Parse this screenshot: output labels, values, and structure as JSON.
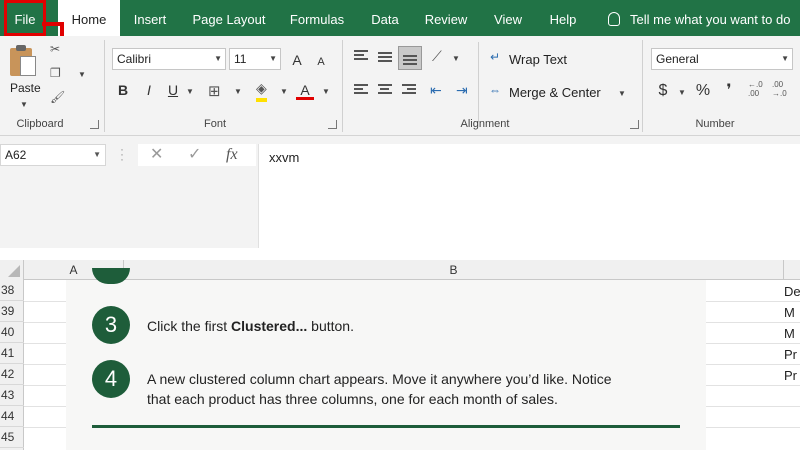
{
  "ribbon_tabs": {
    "file": "File",
    "home": "Home",
    "insert": "Insert",
    "page_layout": "Page Layout",
    "formulas": "Formulas",
    "data": "Data",
    "review": "Review",
    "view": "View",
    "help": "Help",
    "tell_me": "Tell me what you want to do"
  },
  "clipboard": {
    "paste": "Paste",
    "label": "Clipboard"
  },
  "font": {
    "name": "Calibri",
    "size": "11",
    "label": "Font",
    "bold": "B",
    "italic": "I",
    "underline": "U",
    "increase": "A",
    "decrease": "A",
    "color_letter": "A"
  },
  "alignment": {
    "wrap_text": "Wrap Text",
    "merge_center": "Merge & Center",
    "label": "Alignment"
  },
  "number": {
    "format": "General",
    "label": "Number",
    "currency": "$",
    "percent": "%",
    "comma": "❜"
  },
  "formula_bar": {
    "name_box": "A62",
    "cancel": "✕",
    "enter": "✓",
    "fx": "fx",
    "content": "xxvm"
  },
  "columns": [
    "A",
    "B"
  ],
  "rows": [
    "38",
    "39",
    "40",
    "41",
    "42",
    "43",
    "44",
    "45"
  ],
  "card": {
    "step3_number": "3",
    "step3_pre": "Click the first ",
    "step3_bold": "Clustered...",
    "step3_post": " button.",
    "step4_number": "4",
    "step4_line1": "A new clustered column chart appears. Move it anywhere you’d like. Notice",
    "step4_line2": "that each product has three columns, one for each month of sales."
  },
  "right_cells": [
    "De",
    "M",
    "M",
    "Pr",
    "Pr"
  ],
  "colors": {
    "ribbon_green": "#217346",
    "accent_dark_green": "#1e5d3a",
    "highlight_red": "#e00000"
  }
}
